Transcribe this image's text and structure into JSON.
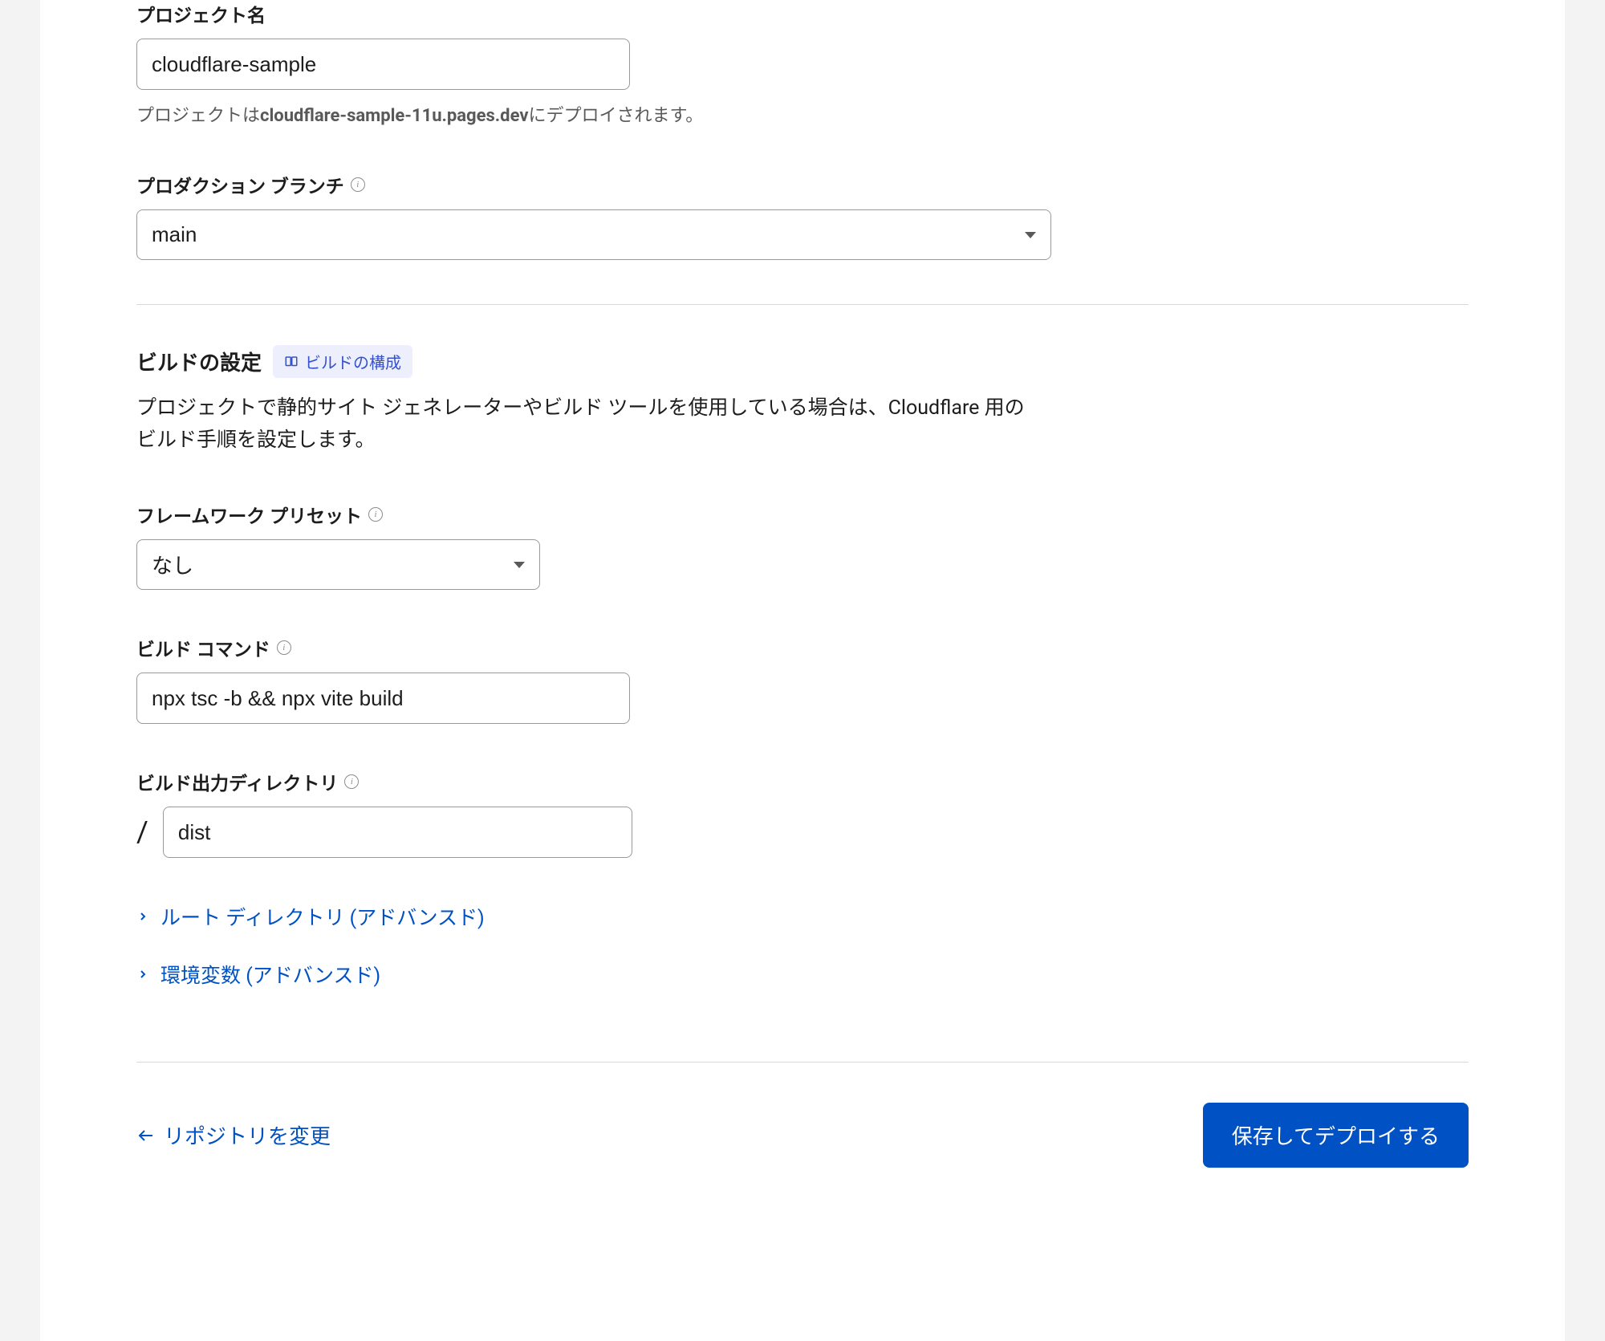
{
  "project_name": {
    "label": "プロジェクト名",
    "value": "cloudflare-sample",
    "help_prefix": "プロジェクトは",
    "help_domain": "cloudflare-sample-11u.pages.dev",
    "help_suffix": "にデプロイされます。"
  },
  "production_branch": {
    "label": "プロダクション ブランチ",
    "value": "main"
  },
  "build_settings": {
    "title": "ビルドの設定",
    "pill_label": "ビルドの構成",
    "description": "プロジェクトで静的サイト ジェネレーターやビルド ツールを使用している場合は、Cloudflare 用のビルド手順を設定します。"
  },
  "framework_preset": {
    "label": "フレームワーク プリセット",
    "value": "なし"
  },
  "build_command": {
    "label": "ビルド コマンド",
    "value": "npx tsc -b && npx vite build"
  },
  "build_output": {
    "label": "ビルド出力ディレクトリ",
    "value": "dist",
    "prefix": "/"
  },
  "advanced": {
    "root_dir": "ルート ディレクトリ (アドバンスド)",
    "env_vars": "環境変数 (アドバンスド)"
  },
  "footer": {
    "back": "リポジトリを変更",
    "submit": "保存してデプロイする"
  }
}
